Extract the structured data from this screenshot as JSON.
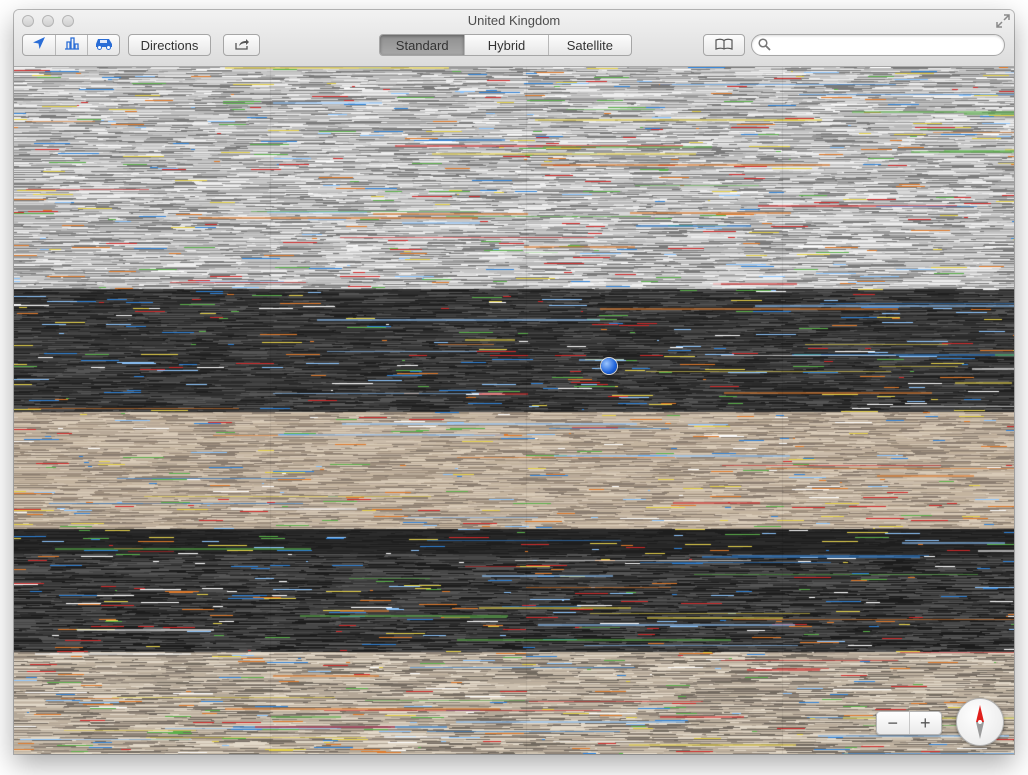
{
  "window": {
    "title": "United Kingdom"
  },
  "toolbar": {
    "directions_label": "Directions",
    "map_modes": [
      {
        "label": "Standard",
        "selected": true
      },
      {
        "label": "Hybrid",
        "selected": false
      },
      {
        "label": "Satellite",
        "selected": false
      }
    ],
    "search_placeholder": ""
  },
  "icons": {
    "location": "location-arrow-icon",
    "3d": "3d-buildings-icon",
    "traffic": "car-icon",
    "share": "share-icon",
    "bookmarks": "book-icon",
    "search": "magnifier-icon",
    "compass": "compass-icon",
    "fullscreen": "fullscreen-icon"
  },
  "map_controls": {
    "zoom_out_label": "−",
    "zoom_in_label": "+"
  },
  "colors": {
    "accent": "#2a6dd6",
    "selected_segment": "#9a9a9a",
    "compass_needle": "#e0201c"
  }
}
